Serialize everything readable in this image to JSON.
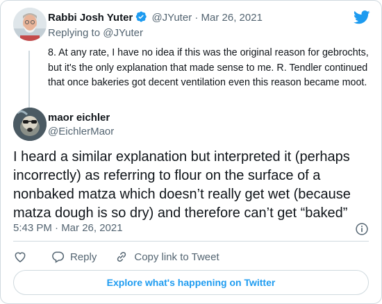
{
  "parent_tweet": {
    "author_name": "Rabbi Josh Yuter",
    "author_handle": "@JYuter",
    "date": "· Mar 26, 2021",
    "replying_to": "Replying to @JYuter",
    "text": "8. At any rate, I have no idea if this was the original reason for gebrochts, but it's the only explanation that made sense to me. R. Tendler continued that once bakeries got decent ventilation even this reason became moot."
  },
  "reply_tweet": {
    "author_name": "maor eichler",
    "author_handle": "@EichlerMaor",
    "text": "I heard a similar explanation but interpreted it (perhaps incorrectly) as referring to flour on the surface of a nonbaked matza which doesn’t really get wet (because matza dough is so dry) and therefore can’t get “baked”",
    "timestamp": "5:43 PM · Mar 26, 2021"
  },
  "actions": {
    "like_icon": "heart-icon",
    "reply_label": "Reply",
    "copy_link_label": "Copy link to Tweet"
  },
  "explore_label": "Explore what's happening on Twitter",
  "colors": {
    "accent": "#1d9bf0",
    "muted": "#536471",
    "border": "#cfd9de"
  }
}
